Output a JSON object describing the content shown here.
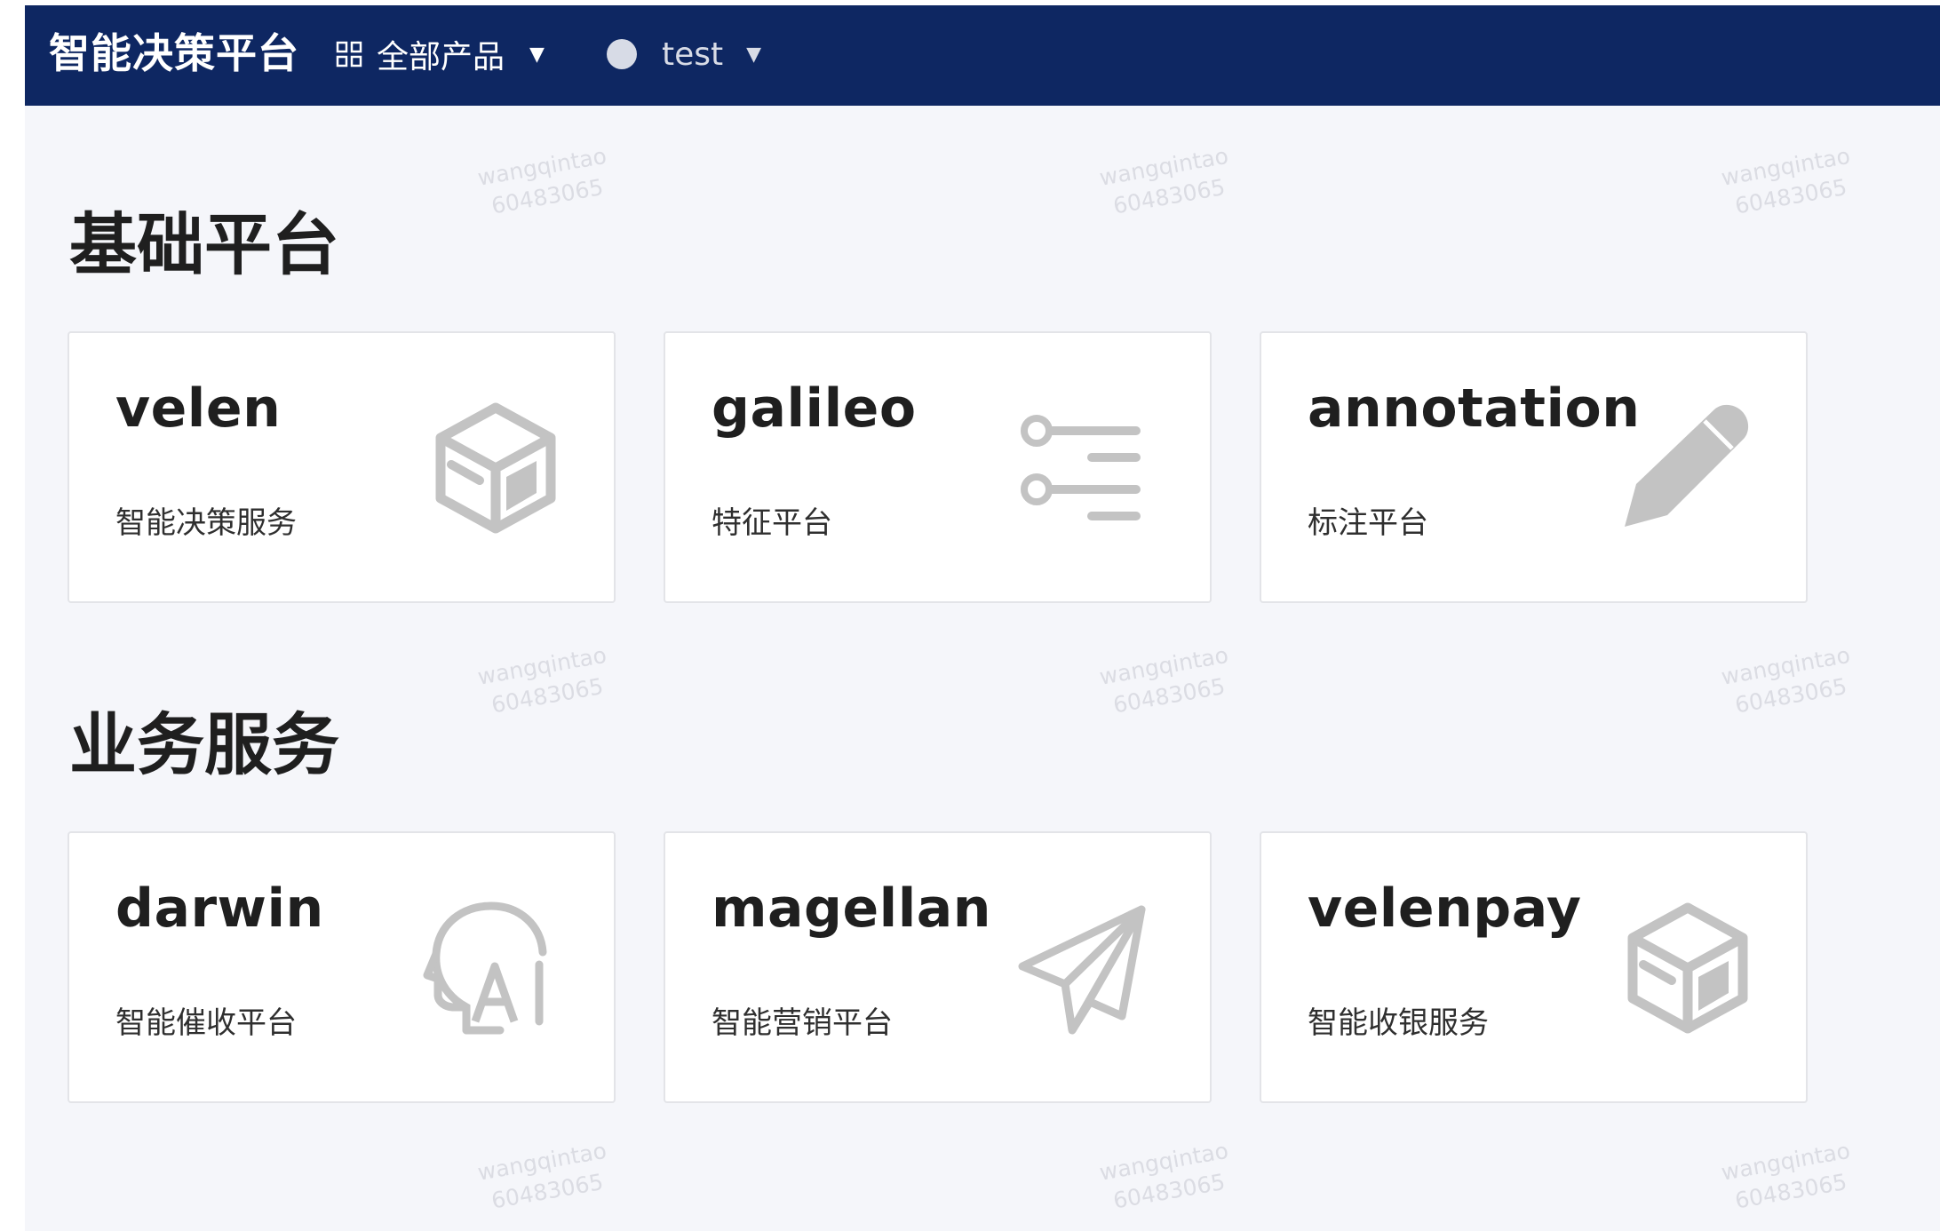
{
  "header": {
    "brand": "智能决策平台",
    "products_label": "全部产品",
    "user_label": "test"
  },
  "icons": {
    "grid": "grid-icon",
    "caret": "caret-down-icon",
    "user": "user-avatar-icon",
    "cube": "cube-icon",
    "filter_list": "filter-list-icon",
    "pencil": "pencil-icon",
    "ai_head": "ai-head-icon",
    "paper_plane": "paper-plane-icon"
  },
  "sections": [
    {
      "title": "基础平台",
      "cards": [
        {
          "name": "velen",
          "desc": "智能决策服务",
          "icon": "cube-icon"
        },
        {
          "name": "galileo",
          "desc": "特征平台",
          "icon": "filter-list-icon"
        },
        {
          "name": "annotation",
          "desc": "标注平台",
          "icon": "pencil-icon"
        }
      ]
    },
    {
      "title": "业务服务",
      "cards": [
        {
          "name": "darwin",
          "desc": "智能催收平台",
          "icon": "ai-head-icon"
        },
        {
          "name": "magellan",
          "desc": "智能营销平台",
          "icon": "paper-plane-icon"
        },
        {
          "name": "velenpay",
          "desc": "智能收银服务",
          "icon": "cube-icon"
        }
      ]
    }
  ],
  "watermark": {
    "line1": "wangqintao",
    "line2": "60483065"
  },
  "colors": {
    "header_bg": "#0e2762",
    "page_bg": "#f5f6fa",
    "icon_gray": "#c3c3c3"
  }
}
